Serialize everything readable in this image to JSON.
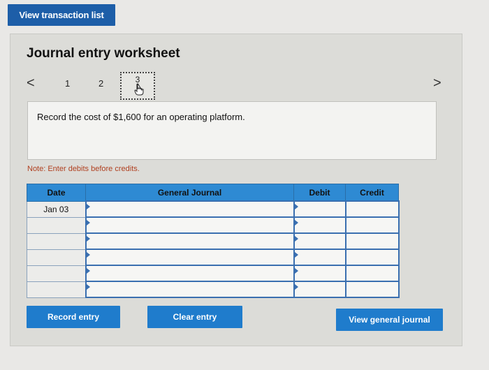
{
  "top": {
    "view_transaction_list": "View transaction list"
  },
  "worksheet": {
    "title": "Journal entry worksheet",
    "nav": {
      "prev": "<",
      "next": ">",
      "steps": [
        "1",
        "2",
        "3"
      ]
    },
    "instruction": "Record the cost of $1,600 for an operating platform.",
    "note": "Note: Enter debits before credits."
  },
  "table": {
    "headers": [
      "Date",
      "General Journal",
      "Debit",
      "Credit"
    ],
    "rows": [
      {
        "date": "Jan 03",
        "account": "",
        "debit": "",
        "credit": ""
      },
      {
        "date": "",
        "account": "",
        "debit": "",
        "credit": ""
      },
      {
        "date": "",
        "account": "",
        "debit": "",
        "credit": ""
      },
      {
        "date": "",
        "account": "",
        "debit": "",
        "credit": ""
      },
      {
        "date": "",
        "account": "",
        "debit": "",
        "credit": ""
      },
      {
        "date": "",
        "account": "",
        "debit": "",
        "credit": ""
      }
    ]
  },
  "buttons": {
    "record": "Record entry",
    "clear": "Clear entry",
    "view_general_journal": "View general journal"
  },
  "icons": {
    "step3_cursor": "hand-pointer-icon"
  }
}
